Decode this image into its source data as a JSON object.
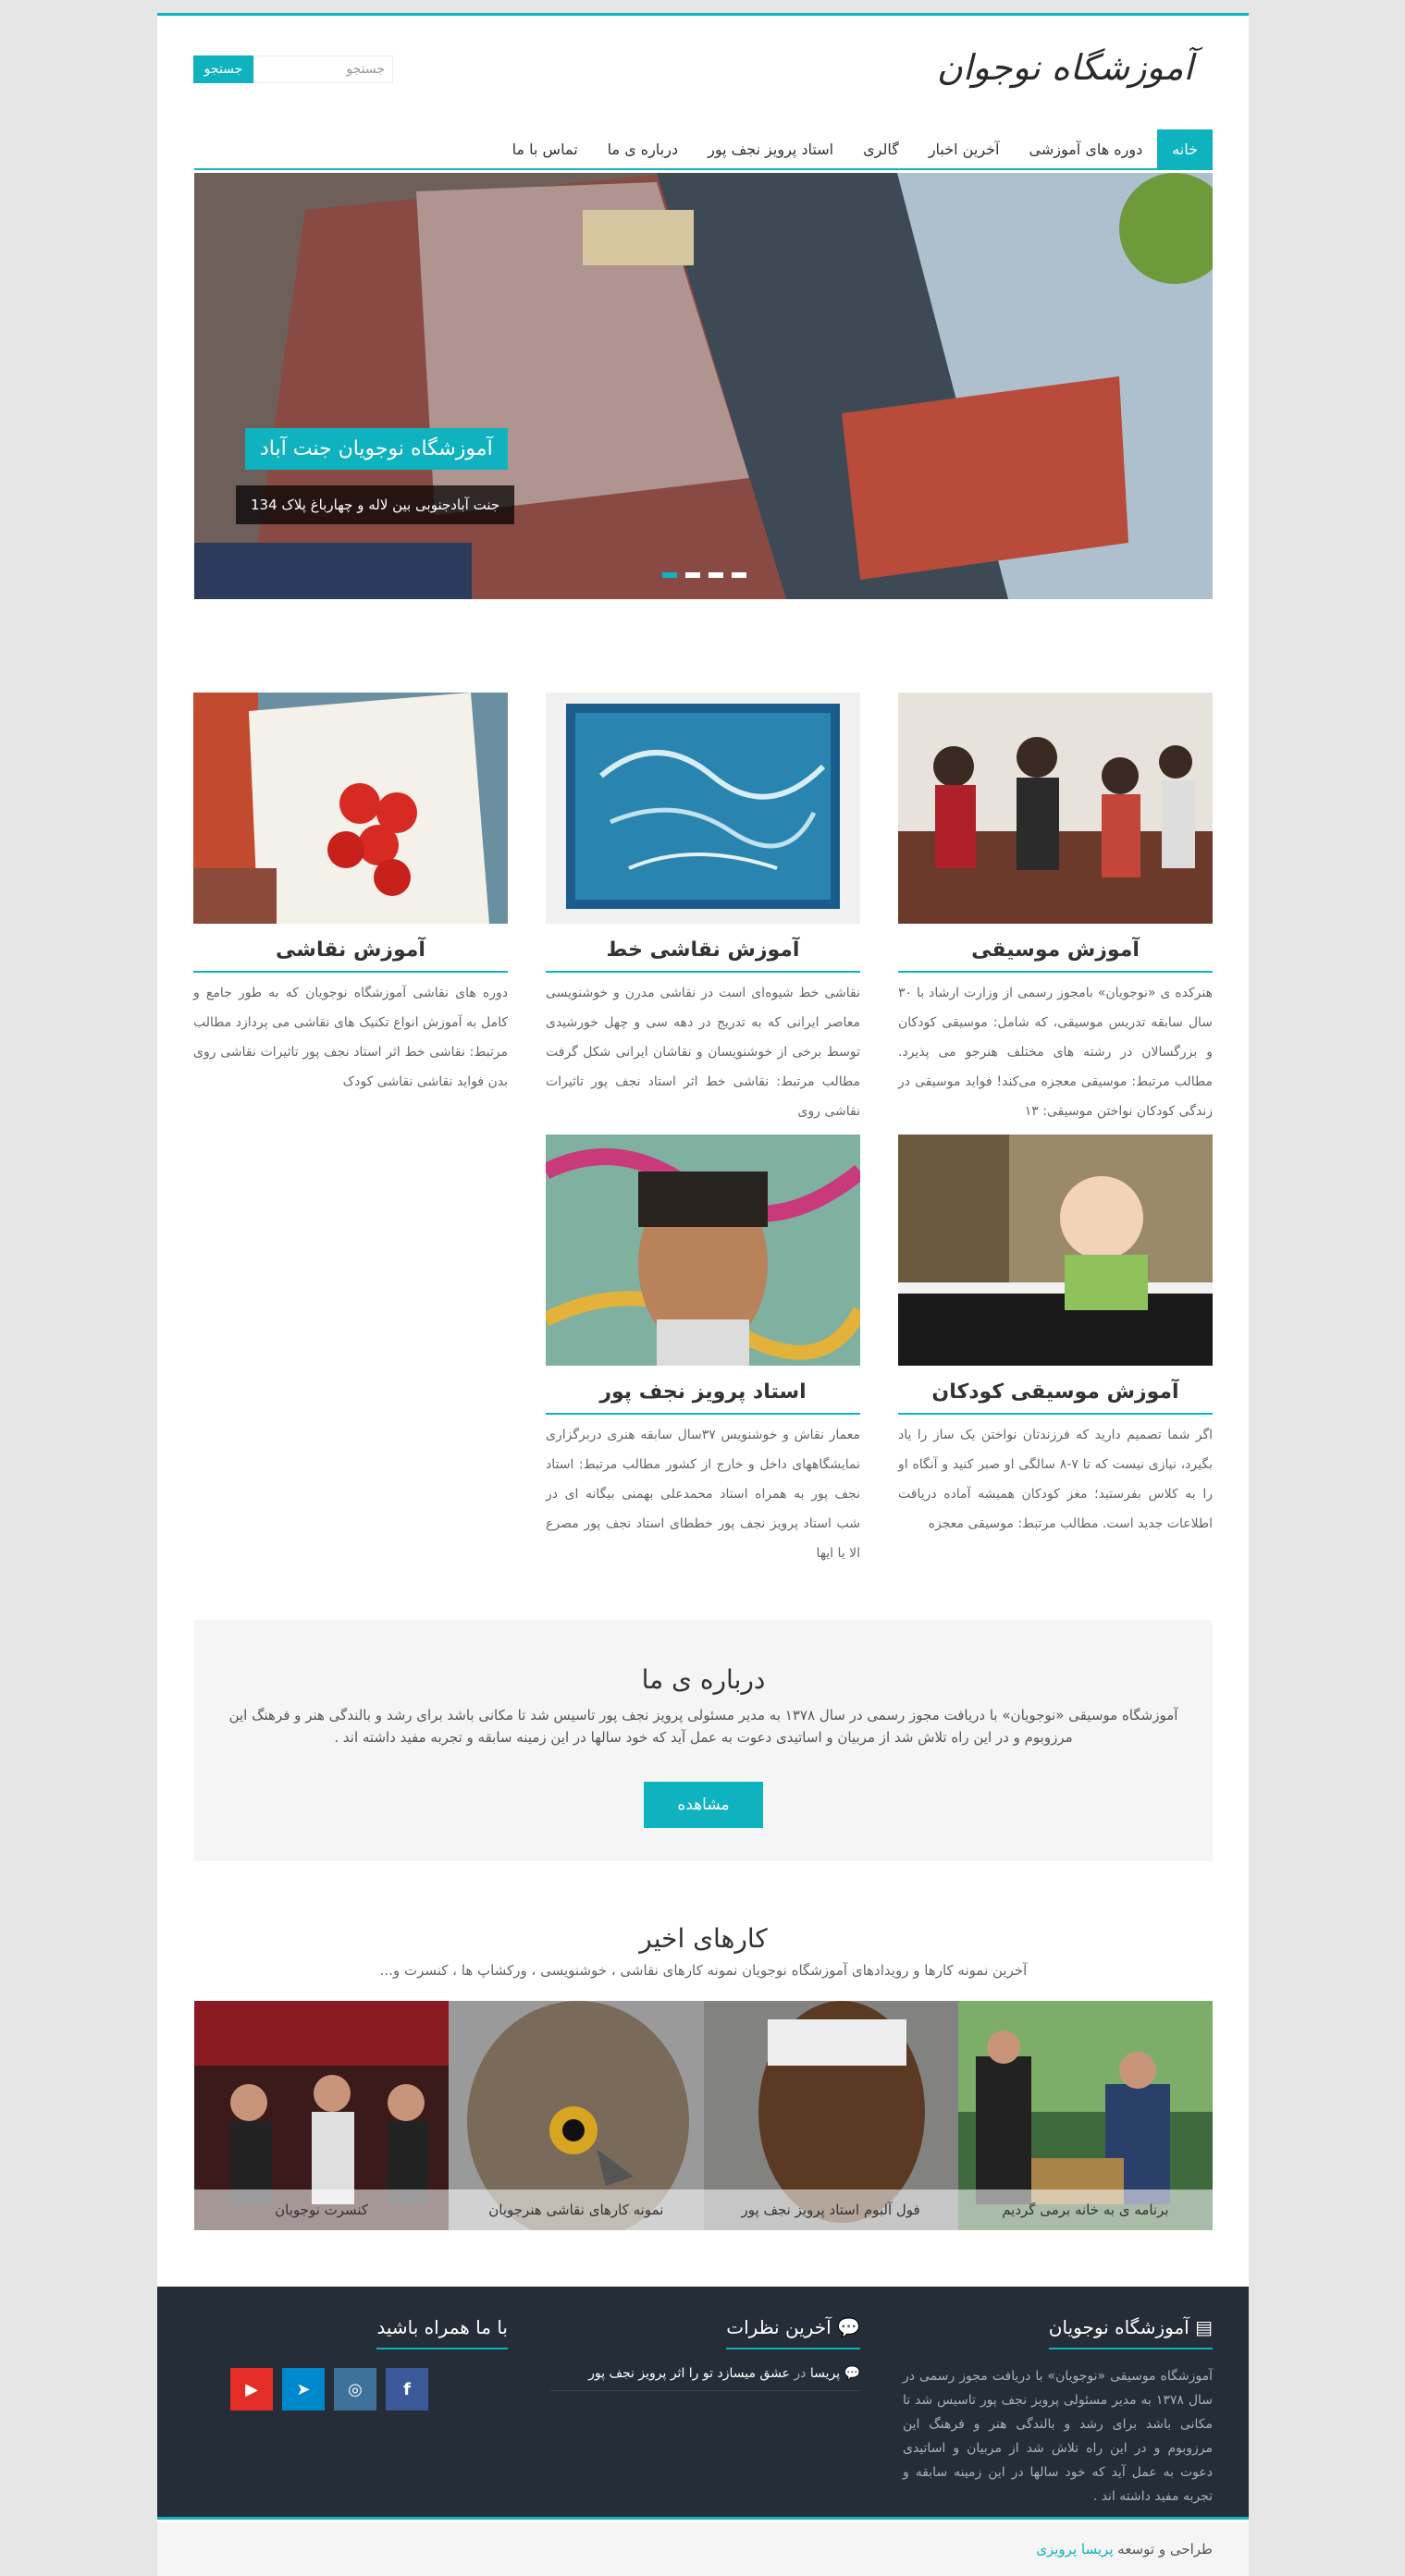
{
  "header": {
    "logo_text": "آموزشگاه نوجوان",
    "search_placeholder": "جستجو",
    "search_button": "جستجو"
  },
  "nav": {
    "items": [
      {
        "label": "خانه",
        "active": true
      },
      {
        "label": "دوره های آموزشی",
        "active": false
      },
      {
        "label": "آخرین اخبار",
        "active": false
      },
      {
        "label": "گالری",
        "active": false
      },
      {
        "label": "استاد پرویز نجف پور",
        "active": false
      },
      {
        "label": "درباره ی ما",
        "active": false
      },
      {
        "label": "تماس با ما",
        "active": false
      }
    ]
  },
  "slider": {
    "title": "آموزشگاه نوجویان جنت آباد",
    "subtitle": "جنت آبادجنوبی بین لاله و چهارباغ پلاک 134",
    "slide_count": 4,
    "active_slide": 1
  },
  "services": [
    {
      "title": "آموزش موسیقی",
      "text": "هنرکده ی «نوجویان» بامجوز رسمی از وزارت ارشاد با ۳۰ سال سابقه تدریس موسیقی، که شامل: موسیقی کودکان و بزرگسالان در رشته های مختلف هنرجو می پذیرد. مطالب مرتبط: موسیقی معجزه می‌کند! فواید موسیقی در زندگی کودکان نواختن موسیقی: ۱۳"
    },
    {
      "title": "آموزش نقاشی خط",
      "text": "نقاشی خط شیوه‌ای است در نقاشی مدرن و خوشنویسی معاصر ایرانی که به تدریج در دهه سی و چهل خورشیدی توسط برخی از خوشنویسان و نقاشان ایرانی شکل گرفت مطالب مرتبط: نقاشی خط اثر استاد نجف پور تاثیرات نقاشی روی"
    },
    {
      "title": "آموزش نقاشی",
      "text": "دوره های نقاشی آموزشگاه نوجویان که به طور جامع و کامل به آموزش انواع تکنیک های نقاشی می پردازد مطالب مرتبط: نقاشی خط اثر استاد نجف پور تاثیرات نقاشی روی بدن فواید نقاشی نقاشی کودک"
    },
    {
      "title": "آموزش موسیقی کودکان",
      "text": "اگر شما تصمیم دارید که فرزندتان نواختن یک ساز را یاد بگیرد، نیازی نیست که تا ۷-۸ سالگی او صبر کنید و آنگاه او را به کلاس بفرستید؛ مغز کودکان همیشه آماده دریافت اطلاعات جدید است. مطالب مرتبط: موسیقی معجزه"
    },
    {
      "title": "استاد پرویز نجف پور",
      "text": "معمار نقاش و خوشنویس ۳۷سال سابقه هنری دربرگزاری نمایشگاههای داخل و خارج از کشور مطالب مرتبط: استاد نجف پور به همراه استاد محمدعلی بهمنی بیگانه ای در شب استاد پرویز نجف پور خططای استاد نجف پور مصرع الا یا ایها"
    }
  ],
  "about": {
    "title": "درباره ی ما",
    "text": "آموزشگاه موسیقی «نوجویان» با دریافت مجوز رسمی در سال ۱۳۷۸ به مدیر مسئولی پرویز نجف پور تاسیس شد تا مکانی باشد برای رشد و بالندگی هنر و فرهنگ این مرزوبوم و در این راه تلاش شد از مربیان و اساتیدی دعوت به عمل آید که خود سالها در این زمینه سابقه و تجربه مفید داشته اند .",
    "button": "مشاهده"
  },
  "recent": {
    "title": "کارهای اخیر",
    "subtitle": "آخرین نمونه کارها و رویدادهای آموزشگاه نوجویان نمونه کارهای نقاشی ، خوشنویسی ، ورکشاپ ها ، کنسرت و...",
    "items": [
      {
        "caption": "برنامه ی به خانه برمی گردیم"
      },
      {
        "caption": "فول آلبوم استاد پرویز نجف پور"
      },
      {
        "caption": "نمونه کارهای نقاشی هنرجویان"
      },
      {
        "caption": "کنسرت نوجویان"
      }
    ]
  },
  "footer": {
    "about_title": "آموزشگاه نوجویان",
    "about_text": "آموزشگاه موسیقی «نوجویان» با دریافت مجوز رسمی در سال ۱۳۷۸ به مدیر مسئولی پرویز نجف پور تاسیس شد تا مکانی باشد برای رشد و بالندگی هنر و فرهنگ این مرزوبوم و در این راه تلاش شد از مربیان و اساتیدی دعوت به عمل آید که خود سالها در این زمینه سابقه و تجربه مفید داشته اند .",
    "comments_title": "آخرین نظرات",
    "comment_author": "پریسا",
    "comment_in": "در",
    "comment_post": "عشق میسازد تو را اثر پرویز نجف پور",
    "social_title": "با ما همراه باشید",
    "socials": [
      {
        "icon": "facebook-icon",
        "glyph": "f",
        "color": "#3b5998"
      },
      {
        "icon": "instagram-icon",
        "glyph": "◎",
        "color": "#3f729b"
      },
      {
        "icon": "telegram-icon",
        "glyph": "➤",
        "color": "#0088cc"
      },
      {
        "icon": "youtube-icon",
        "glyph": "▶",
        "color": "#e52d27"
      }
    ]
  },
  "credit": {
    "prefix": "طراحی و توسعه",
    "author": "پریسا پرویزی"
  },
  "colors": {
    "accent": "#0fb2bf",
    "footer_bg": "#252d38"
  }
}
